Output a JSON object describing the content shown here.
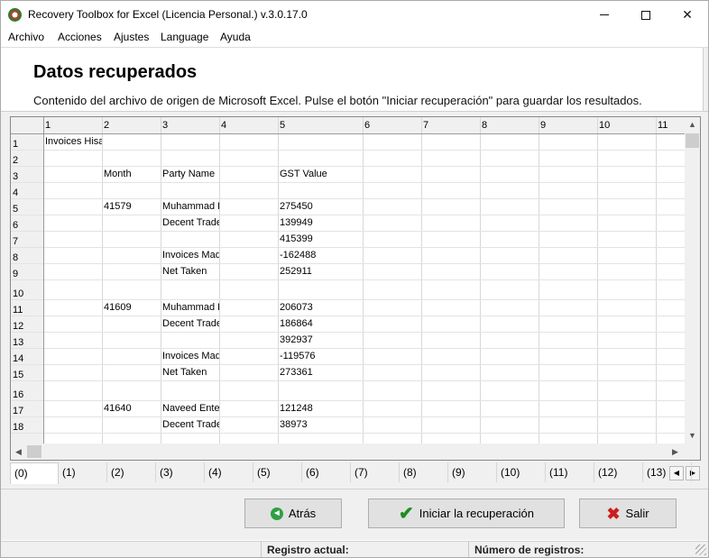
{
  "window": {
    "title": "Recovery Toolbox for Excel (Licencia Personal.) v.3.0.17.0",
    "controls": {
      "minimize": "—",
      "maximize": "☐",
      "close": "✕"
    }
  },
  "menu": [
    "Archivo",
    "Acciones",
    "Ajustes",
    "Language",
    "Ayuda"
  ],
  "header": {
    "title": "Datos recuperados",
    "description": "Contenido del archivo de origen de Microsoft Excel. Pulse el botón \"Iniciar recuperación\" para guardar los resultados."
  },
  "grid": {
    "columns": [
      "1",
      "2",
      "3",
      "4",
      "5",
      "6",
      "7",
      "8",
      "9",
      "10",
      "11"
    ],
    "rows": [
      {
        "n": "1",
        "cells": [
          "Invoices Hisa",
          "",
          "",
          "",
          "",
          "",
          "",
          "",
          "",
          "",
          ""
        ]
      },
      {
        "n": "2",
        "cells": [
          "",
          "",
          "",
          "",
          "",
          "",
          "",
          "",
          "",
          "",
          ""
        ]
      },
      {
        "n": "3",
        "cells": [
          "",
          "Month",
          "Party Name",
          "",
          "GST Value",
          "",
          "",
          "",
          "",
          "",
          ""
        ]
      },
      {
        "n": "4",
        "cells": [
          "",
          "",
          "",
          "",
          "",
          "",
          "",
          "",
          "",
          "",
          ""
        ]
      },
      {
        "n": "5",
        "cells": [
          "",
          "41579",
          "Muhammad H",
          "",
          "275450",
          "",
          "",
          "",
          "",
          "",
          ""
        ]
      },
      {
        "n": "6",
        "cells": [
          "",
          "",
          "Decent Trade",
          "",
          "139949",
          "",
          "",
          "",
          "",
          "",
          ""
        ]
      },
      {
        "n": "7",
        "cells": [
          "",
          "",
          "",
          "",
          "415399",
          "",
          "",
          "",
          "",
          "",
          ""
        ]
      },
      {
        "n": "8",
        "cells": [
          "",
          "",
          "Invoices Mad",
          "",
          "-162488",
          "",
          "",
          "",
          "",
          "",
          ""
        ]
      },
      {
        "n": "9",
        "cells": [
          "",
          "",
          "Net Taken",
          "",
          "252911",
          "",
          "",
          "",
          "",
          "",
          ""
        ]
      },
      {
        "n": "10",
        "cells": [
          "",
          "",
          "",
          "",
          "",
          "",
          "",
          "",
          "",
          "",
          ""
        ]
      },
      {
        "n": "11",
        "cells": [
          "",
          "41609",
          "Muhammad H",
          "",
          "206073",
          "",
          "",
          "",
          "",
          "",
          ""
        ]
      },
      {
        "n": "12",
        "cells": [
          "",
          "",
          "Decent Trade",
          "",
          "186864",
          "",
          "",
          "",
          "",
          "",
          ""
        ]
      },
      {
        "n": "13",
        "cells": [
          "",
          "",
          "",
          "",
          "392937",
          "",
          "",
          "",
          "",
          "",
          ""
        ]
      },
      {
        "n": "14",
        "cells": [
          "",
          "",
          "Invoices Mad",
          "",
          "-119576",
          "",
          "",
          "",
          "",
          "",
          ""
        ]
      },
      {
        "n": "15",
        "cells": [
          "",
          "",
          "Net Taken",
          "",
          "273361",
          "",
          "",
          "",
          "",
          "",
          ""
        ]
      },
      {
        "n": "16",
        "cells": [
          "",
          "",
          "",
          "",
          "",
          "",
          "",
          "",
          "",
          "",
          ""
        ]
      },
      {
        "n": "17",
        "cells": [
          "",
          "41640",
          "Naveed Enter",
          "",
          "121248",
          "",
          "",
          "",
          "",
          "",
          ""
        ]
      },
      {
        "n": "18",
        "cells": [
          "",
          "",
          "Decent Trade",
          "",
          "38973",
          "",
          "",
          "",
          "",
          "",
          ""
        ]
      }
    ]
  },
  "sheet_tabs": [
    "(0)",
    "(1)",
    "(2)",
    "(3)",
    "(4)",
    "(5)",
    "(6)",
    "(7)",
    "(8)",
    "(9)",
    "(10)",
    "(11)",
    "(12)",
    "(13)"
  ],
  "active_tab": "(0)",
  "buttons": {
    "back": "Atrás",
    "start": "Iniciar la recuperación",
    "exit": "Salir"
  },
  "status": {
    "current_record": "Registro actual:",
    "record_count": "Número de registros:"
  }
}
